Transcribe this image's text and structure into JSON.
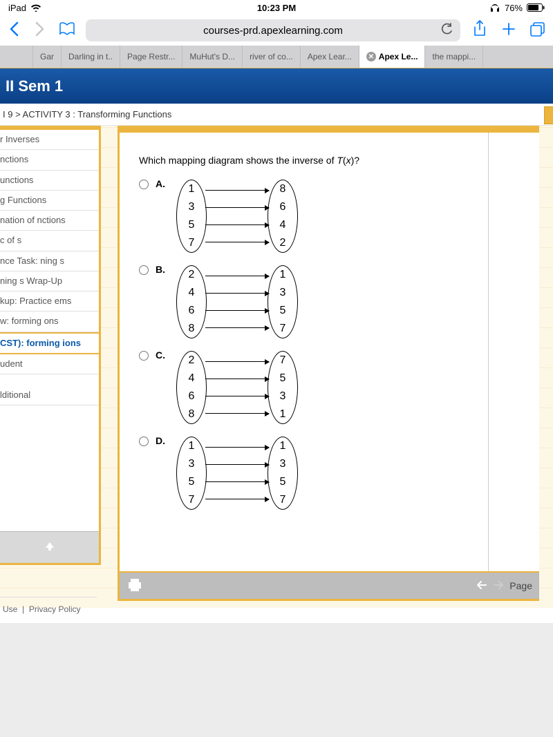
{
  "status": {
    "device": "iPad",
    "time": "10:23 PM",
    "battery": "76%"
  },
  "safari": {
    "url": "courses-prd.apexlearning.com"
  },
  "tabs": {
    "t0": "Gar",
    "t1": "Darling in t..",
    "t2": "Page Restr...",
    "t3": "MuHut's D...",
    "t4": "river of co...",
    "t5": "Apex Lear...",
    "t6": "Apex Le...",
    "t7": "the mappi..."
  },
  "course": {
    "title": "II Sem 1",
    "breadcrumb": "I 9 > ACTIVITY 3 : Transforming Functions"
  },
  "sidebar": {
    "items": {
      "i0": "r Inverses",
      "i1": "nctions",
      "i2": "unctions",
      "i3": "g Functions",
      "i4": "nation of\nnctions",
      "i5": "c of\ns",
      "i6": "nce Task:\nning\ns",
      "i7": "ning\ns Wrap-Up",
      "i8": "kup: Practice\nems",
      "i9": "w:\nforming\nons",
      "i10": "CST):\nforming\nions",
      "i11": "udent",
      "i12": "lditional"
    }
  },
  "question": {
    "prompt_pre": "Which mapping diagram shows the inverse of ",
    "prompt_fn": "T",
    "prompt_arg": "x",
    "prompt_post": ")?",
    "choices": {
      "a": {
        "label": "A.",
        "left": [
          "1",
          "3",
          "5",
          "7"
        ],
        "right": [
          "8",
          "6",
          "4",
          "2"
        ]
      },
      "b": {
        "label": "B.",
        "left": [
          "2",
          "4",
          "6",
          "8"
        ],
        "right": [
          "1",
          "3",
          "5",
          "7"
        ]
      },
      "c": {
        "label": "C.",
        "left": [
          "2",
          "4",
          "6",
          "8"
        ],
        "right": [
          "7",
          "5",
          "3",
          "1"
        ]
      },
      "d": {
        "label": "D.",
        "left": [
          "1",
          "3",
          "5",
          "7"
        ],
        "right": [
          "1",
          "3",
          "5",
          "7"
        ]
      }
    }
  },
  "footer": {
    "use": "Use",
    "sep": "|",
    "privacy": "Privacy Policy",
    "page": "Page"
  }
}
